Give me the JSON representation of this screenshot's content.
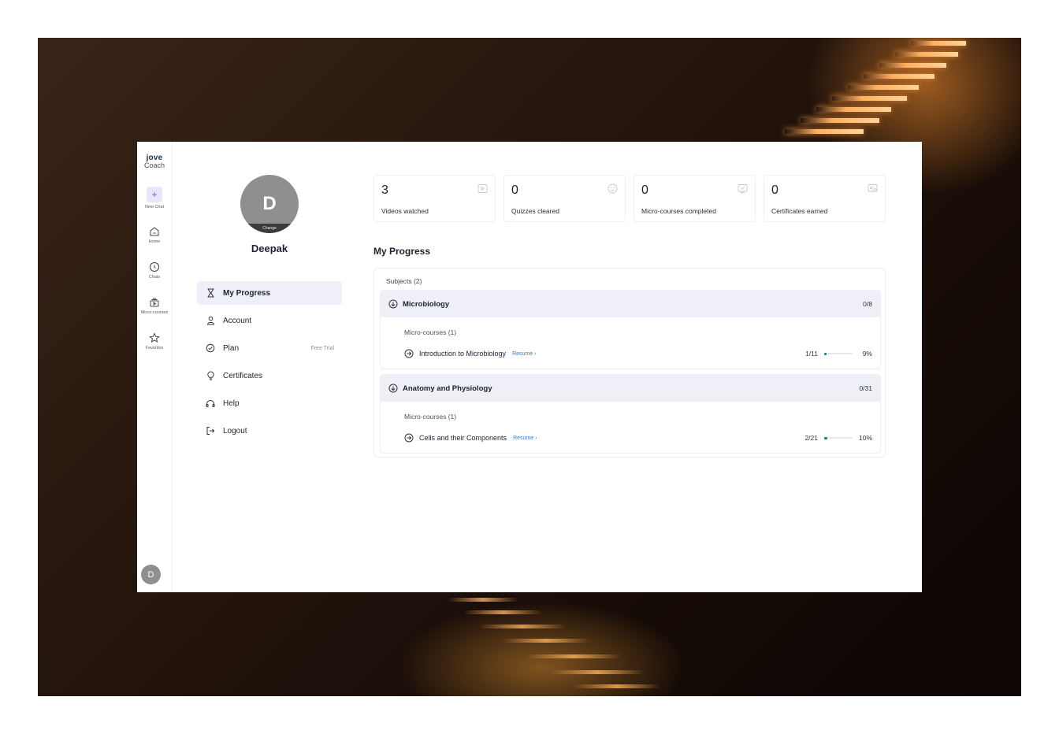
{
  "logo": {
    "line1": "jove",
    "line2": "Coach"
  },
  "rail": {
    "new_chat": "New Chat",
    "home": "Home",
    "chats": "Chats",
    "micro_courses": "Micro-courses",
    "favorites": "Favorites",
    "avatar_initial": "D"
  },
  "profile": {
    "initial": "D",
    "change_label": "Change",
    "name": "Deepak"
  },
  "menu": {
    "my_progress": "My Progress",
    "account": "Account",
    "plan": "Plan",
    "plan_tag": "Free Trial",
    "certificates": "Certificates",
    "help": "Help",
    "logout": "Logout"
  },
  "stats": [
    {
      "value": "3",
      "label": "Videos watched"
    },
    {
      "value": "0",
      "label": "Quizzes cleared"
    },
    {
      "value": "0",
      "label": "Micro-courses completed"
    },
    {
      "value": "0",
      "label": "Certificates earned"
    }
  ],
  "progress": {
    "title": "My Progress",
    "subjects_label": "Subjects  (2)",
    "subjects": [
      {
        "name": "Microbiology",
        "count": "0/8",
        "micro_label": "Micro-courses  (1)",
        "course": {
          "title": "Introduction to Microbiology",
          "resume": "Resume ›",
          "fraction": "1/11",
          "percent": "9%",
          "progress": 0.09
        }
      },
      {
        "name": "Anatomy and Physiology",
        "count": "0/31",
        "micro_label": "Micro-courses  (1)",
        "course": {
          "title": "Cells and their Components",
          "resume": "Resume ›",
          "fraction": "2/21",
          "percent": "10%",
          "progress": 0.1
        }
      }
    ]
  },
  "colors": {
    "accent": "#6b5fd3",
    "active_bg": "#efeff8",
    "link": "#3a7bd5",
    "progress_fill": "#2f7a84"
  }
}
